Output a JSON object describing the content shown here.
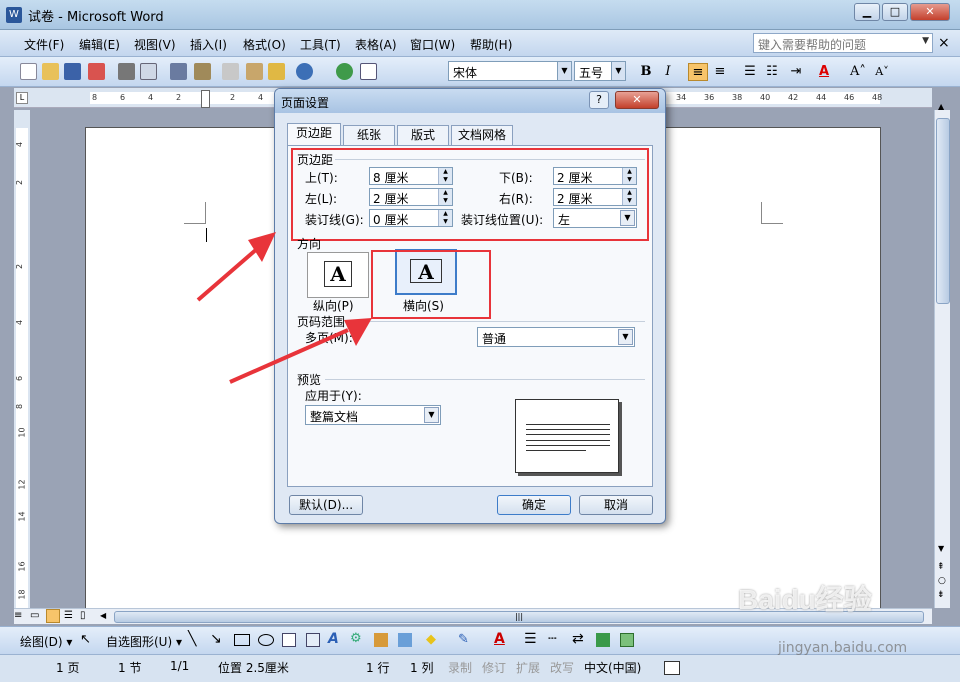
{
  "window": {
    "title": "试卷 - Microsoft Word",
    "minimize": "▁",
    "maximize": "□",
    "close": "✕"
  },
  "menubar": {
    "items": [
      "文件(F)",
      "编辑(E)",
      "视图(V)",
      "插入(I)",
      "格式(O)",
      "工具(T)",
      "表格(A)",
      "窗口(W)",
      "帮助(H)"
    ],
    "help_placeholder": "键入需要帮助的问题",
    "close": "×"
  },
  "toolbar": {
    "font": "宋体",
    "size": "五号",
    "bold": "B",
    "italic": "I",
    "font_color": "A",
    "grow_font": "A˄",
    "shrink_font": "A˅"
  },
  "ruler": {
    "corner": "L",
    "numbers": [
      "8",
      "6",
      "4",
      "2",
      "",
      "2",
      "4",
      "6",
      "34",
      "36",
      "38",
      "40",
      "42",
      "44",
      "46",
      "48"
    ]
  },
  "vertical_ruler": {
    "numbers": [
      "4",
      "2",
      "",
      "2",
      "4",
      "6",
      "8",
      "10",
      "12",
      "14",
      "16",
      "18"
    ]
  },
  "dialog": {
    "title": "页面设置",
    "help": "?",
    "close": "✕",
    "tabs": [
      "页边距",
      "纸张",
      "版式",
      "文档网格"
    ],
    "active_tab": 0,
    "margins_section": "页边距",
    "top_label": "上(T):",
    "top_value": "8 厘米",
    "bottom_label": "下(B):",
    "bottom_value": "2 厘米",
    "left_label": "左(L):",
    "left_value": "2 厘米",
    "right_label": "右(R):",
    "right_value": "2 厘米",
    "gutter_label": "装订线(G):",
    "gutter_value": "0 厘米",
    "gutter_pos_label": "装订线位置(U):",
    "gutter_pos_value": "左",
    "orientation_section": "方向",
    "portrait_label": "纵向(P)",
    "landscape_label": "横向(S)",
    "orientation_glyph": "A",
    "pages_section": "页码范围",
    "multiple_pages_label": "多页(M):",
    "multiple_pages_value": "普通",
    "preview_section": "预览",
    "apply_to_label": "应用于(Y):",
    "apply_to_value": "整篇文档",
    "default_button": "默认(D)...",
    "ok_button": "确定",
    "cancel_button": "取消"
  },
  "drawbar": {
    "draw_menu": "绘图(D) ▾",
    "autoshapes": "自选图形(U) ▾"
  },
  "statusbar": {
    "page": "1 页",
    "section": "1 节",
    "pages": "1/1",
    "position": "位置 2.5厘米",
    "line": "1 行",
    "column": "1 列",
    "rec": "录制",
    "trk": "修订",
    "ext": "扩展",
    "ovr": "改写",
    "language": "中文(中国)"
  },
  "watermark": {
    "text": "Baidu经验",
    "sub": "jingyan.baidu.com"
  },
  "colors": {
    "highlight_box": "#e8343a",
    "arrow": "#e8343a"
  }
}
